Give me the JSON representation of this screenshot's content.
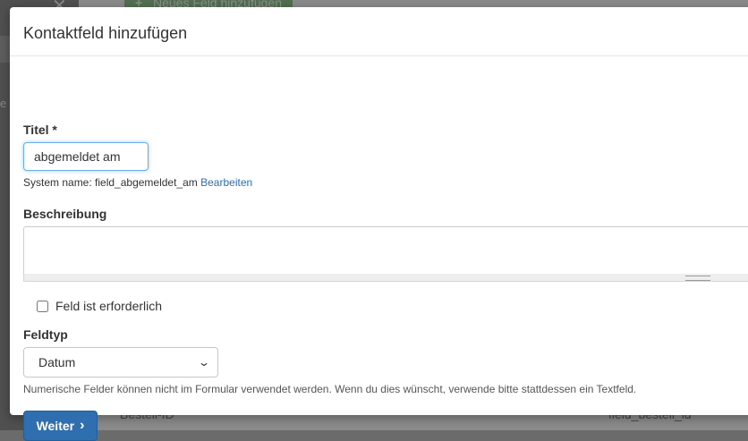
{
  "background": {
    "add_field_button": "Neues Feld hinzufügen",
    "row_left": "Bestell-ID",
    "row_right": "field_bestell_id"
  },
  "modal": {
    "title": "Kontaktfeld hinzufügen",
    "title_label": "Titel *",
    "title_value": "abgemeldet am",
    "system_name_prefix": "System name: field_abgemeldet_am",
    "edit_link": "Bearbeiten",
    "description_label": "Beschreibung",
    "description_value": "",
    "required_label": "Feld ist erforderlich",
    "required_checked": false,
    "field_type_label": "Feldtyp",
    "field_type_selected": "Datum",
    "help_text": "Numerische Felder können nicht im Formular verwendet werden. Wenn du dies wünscht, verwende bitte stattdessen ein Textfeld.",
    "next_button": "Weiter"
  },
  "icons": {
    "next": "chevron-right-icon",
    "select": "chevron-down-icon",
    "background_close": "close-icon",
    "background_add": "plus-icon"
  }
}
